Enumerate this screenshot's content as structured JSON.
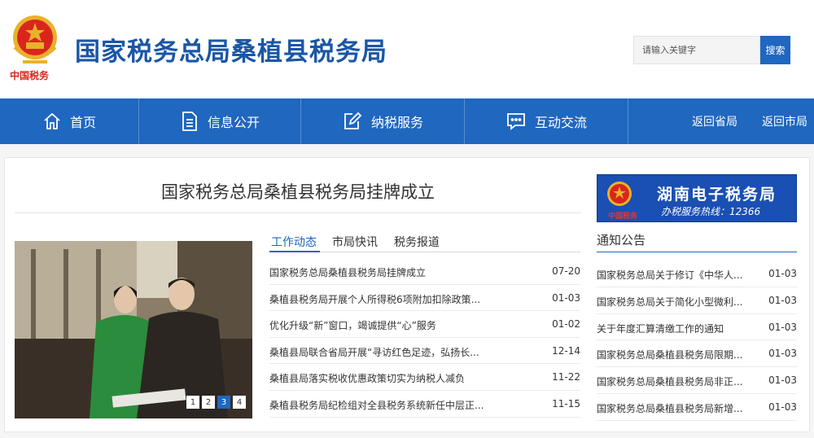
{
  "header": {
    "logo_text": "中国税务",
    "site_title": "国家税务总局桑植县税务局",
    "search_placeholder": "请输入关键字",
    "search_label": "搜索"
  },
  "nav": {
    "items": [
      {
        "label": "首页",
        "icon": "home-icon"
      },
      {
        "label": "信息公开",
        "icon": "document-icon"
      },
      {
        "label": "纳税服务",
        "icon": "edit-icon"
      },
      {
        "label": "互动交流",
        "icon": "chat-icon"
      },
      {
        "label": "返回省局"
      },
      {
        "label": "返回市局"
      }
    ]
  },
  "headline": "国家税务总局桑植县税务局挂牌成立",
  "slideshow": {
    "pages": [
      "1",
      "2",
      "3",
      "4"
    ],
    "active_page": "3"
  },
  "tabs": [
    {
      "label": "工作动态",
      "active": true
    },
    {
      "label": "市局快讯",
      "active": false
    },
    {
      "label": "税务报道",
      "active": false
    }
  ],
  "news": [
    {
      "title": "国家税务总局桑植县税务局挂牌成立",
      "date": "07-20"
    },
    {
      "title": "桑植县税务局开展个人所得税6项附加扣除政策...",
      "date": "01-03"
    },
    {
      "title": "优化升级“新”窗口，竭诚提供“心”服务",
      "date": "01-02"
    },
    {
      "title": "桑植县局联合省局开展“寻访红色足迹，弘扬长...",
      "date": "12-14"
    },
    {
      "title": "桑植县局落实税收优惠政策切实为纳税人减负",
      "date": "11-22"
    },
    {
      "title": "桑植县税务局纪检组对全县税务系统新任中层正...",
      "date": "11-15"
    }
  ],
  "banner": {
    "title": "湖南电子税务局",
    "hotline": "办税服务热线：12366",
    "brand": "中国税务"
  },
  "notices": {
    "heading": "通知公告",
    "items": [
      {
        "title": "国家税务总局关于修订《中华人...",
        "date": "01-03"
      },
      {
        "title": "国家税务总局关于简化小型微利...",
        "date": "01-03"
      },
      {
        "title": "关于年度汇算清缴工作的通知",
        "date": "01-03"
      },
      {
        "title": "国家税务总局桑植县税务局限期...",
        "date": "01-03"
      },
      {
        "title": "国家税务总局桑植县税务局非正...",
        "date": "01-03"
      },
      {
        "title": "国家税务总局桑植县税务局新增...",
        "date": "01-03"
      }
    ]
  },
  "colors": {
    "brand_blue": "#1f67bf",
    "title_blue": "#1a56a6",
    "emblem_red": "#d9261c",
    "emblem_gold": "#e9b22b"
  }
}
